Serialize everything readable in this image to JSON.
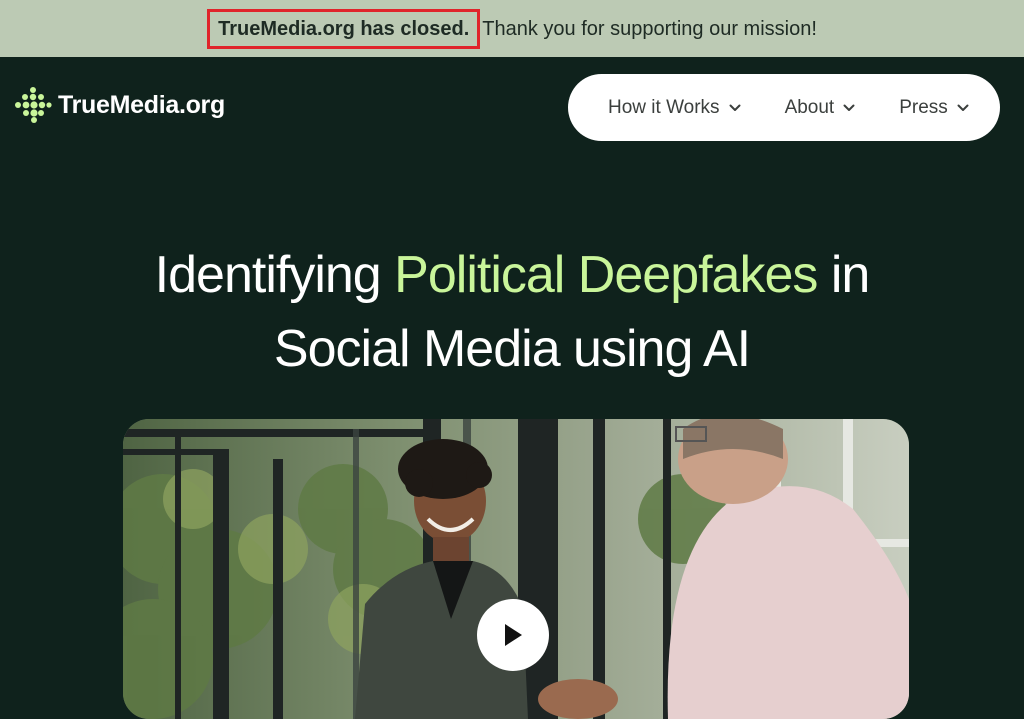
{
  "banner": {
    "closed_text": "TrueMedia.org has closed.",
    "thanks_text": "Thank you for supporting our mission!",
    "highlight_color": "#e0242b"
  },
  "header": {
    "logo_text": "TrueMedia.org",
    "logo_icon": "dots-diamond-icon"
  },
  "nav": {
    "items": [
      {
        "label": "How it Works",
        "icon": "chevron-down-icon"
      },
      {
        "label": "About",
        "icon": "chevron-down-icon"
      },
      {
        "label": "Press",
        "icon": "chevron-down-icon"
      }
    ]
  },
  "hero": {
    "line1_pre": "Identifying ",
    "line1_accent": "Political Deepfakes",
    "line1_post": " in",
    "line2": "Social Media using AI",
    "accent_color": "#c9f59a"
  },
  "video": {
    "play_icon": "play-icon"
  },
  "colors": {
    "background": "#0f221c",
    "banner": "#bccab4"
  }
}
